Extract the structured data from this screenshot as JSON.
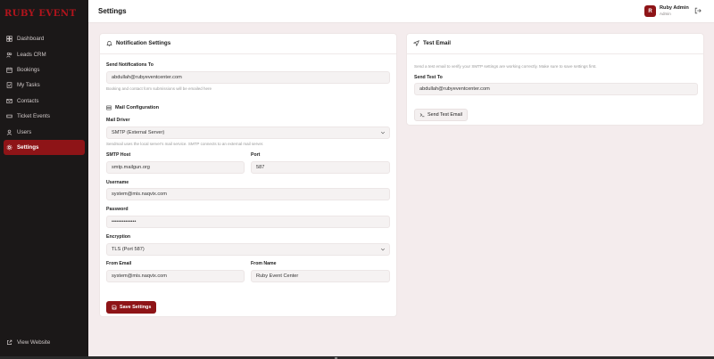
{
  "brand": {
    "logo_text": "RUBY EVENT",
    "accent": "#8e1417"
  },
  "sidebar": {
    "items": [
      {
        "label": "Dashboard",
        "icon": "dashboard-icon",
        "active": false
      },
      {
        "label": "Leads CRM",
        "icon": "users-icon",
        "active": false
      },
      {
        "label": "Bookings",
        "icon": "calendar-icon",
        "active": false
      },
      {
        "label": "My Tasks",
        "icon": "checklist-icon",
        "active": false
      },
      {
        "label": "Contacts",
        "icon": "mail-icon",
        "active": false
      },
      {
        "label": "Ticket Events",
        "icon": "ticket-icon",
        "active": false
      },
      {
        "label": "Users",
        "icon": "user-icon",
        "active": false
      },
      {
        "label": "Settings",
        "icon": "gear-icon",
        "active": true
      }
    ],
    "view_website": "View Website"
  },
  "header": {
    "title": "Settings",
    "user": {
      "initial": "R",
      "name": "Ruby Admin",
      "role": "Admin"
    }
  },
  "notification": {
    "title": "Notification Settings",
    "send_to_label": "Send Notifications To",
    "send_to_value": "abdullah@rubyeventcenter.com",
    "send_to_hint": "Booking and contact form submissions will be emailed here",
    "mail_config_title": "Mail Configuration",
    "mail_driver_label": "Mail Driver",
    "mail_driver_value": "SMTP (External Server)",
    "mail_driver_hint": "Sendmail uses the local server's mail service. SMTP connects to an external mail server.",
    "smtp_host_label": "SMTP Host",
    "smtp_host_value": "smtp.mailgun.org",
    "port_label": "Port",
    "port_value": "587",
    "username_label": "Username",
    "username_value": "system@mis.naqvix.com",
    "password_label": "Password",
    "password_value": "••••••••••••••",
    "encryption_label": "Encryption",
    "encryption_value": "TLS (Port 587)",
    "from_email_label": "From Email",
    "from_email_value": "system@mis.naqvix.com",
    "from_name_label": "From Name",
    "from_name_value": "Ruby Event Center",
    "save_label": "Save Settings"
  },
  "test_email": {
    "title": "Test Email",
    "description": "Send a test email to verify your SMTP settings are working correctly. Make sure to save settings first.",
    "send_to_label": "Send Test To",
    "send_to_value": "abdullah@rubyeventcenter.com",
    "button_label": "Send Test Email"
  }
}
